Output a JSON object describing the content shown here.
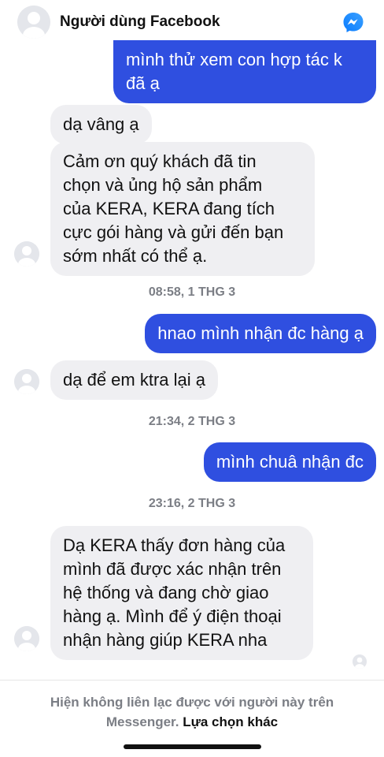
{
  "header": {
    "title": "Người dùng Facebook",
    "avatar_icon": "user-avatar-icon",
    "messenger_icon": "messenger-icon",
    "accent_color": "#2f4fe0"
  },
  "messages": [
    {
      "direction": "outgoing",
      "lines": [
        "mình thử xem con hợp tác k",
        "đã ạ"
      ]
    },
    {
      "direction": "incoming",
      "lines": [
        "dạ vâng ạ"
      ]
    },
    {
      "direction": "incoming",
      "lines": [
        "Cảm ơn quý khách đã tin",
        "chọn và ủng hộ sản phẩm",
        "của KERA, KERA đang tích",
        "cực gói hàng và gửi đến bạn",
        "sớm nhất có thể ạ."
      ]
    },
    {
      "direction": "outgoing",
      "lines": [
        "hnao mình nhận đc hàng ạ"
      ]
    },
    {
      "direction": "incoming",
      "lines": [
        "dạ để em ktra lại ạ"
      ]
    },
    {
      "direction": "outgoing",
      "lines": [
        "mình chuâ nhận đc"
      ]
    },
    {
      "direction": "incoming",
      "lines": [
        "Dạ KERA thấy đơn hàng của",
        "mình đã được xác nhận trên",
        "hệ thống và đang chờ giao",
        "hàng ạ. Mình để ý điện thoại",
        "nhận hàng giúp KERA nha"
      ]
    }
  ],
  "timestamps": [
    "08:58, 1 THG 3",
    "21:34, 2 THG 3",
    "23:16, 2 THG 3"
  ],
  "footer": {
    "notice_line1": "Hiện không liên lạc được với người này trên",
    "notice_line2": "Messenger.",
    "link_text": "Lựa chọn khác"
  }
}
